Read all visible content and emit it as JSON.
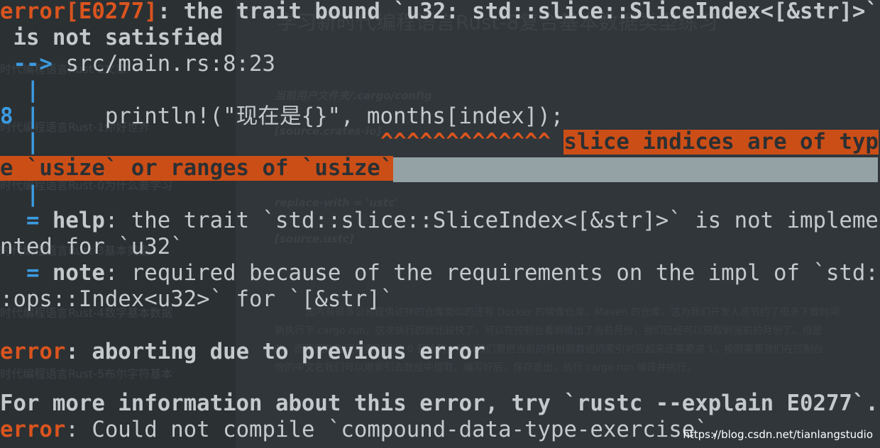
{
  "background_editor": {
    "title": "学习新时代编程语言Rust-8复合基本数据类型练习",
    "sidebar_items": [
      "时代编程语言Rust-2文章",
      "时代编程语言Rust-1你好世界",
      "时代编程语言Rust-0",
      "时代编程语言Rust-0为什么要学习",
      "时代编程语言Rust-3基本类型",
      "时代编程语言Rust-4数字基本数据",
      "时代编程语言Rust-5布尔字符基本"
    ],
    "content_lines": [
      "当前用户文件夹/.cargo/config",
      "[source.crates-io]",
      "replace-with = 'ustc'",
      "[source.ustc]",
      "国内有很多公司提供这样的仓库类似的还有 Docker 的镜像仓库、Maven 的仓库，这为我们开发人员节约了很多下载时间",
      "新执行下 cargo run，这次执行的就比较快了，可以在控制台看到输出了当前月份，我们已经可以获取到当前的月份了。但是",
      "的，而我们的数组的索引是从 0 开始的，所以我们要把当前的月份跟数组的索引对应起来还需要减 1，按照需要我们在控制台",
      "份的中文名我们可以用索引去数组中提取。编写好后，保存退出，执行 cargo run 编译并执行。"
    ]
  },
  "terminal": {
    "l1_err": "error[E0277]",
    "l1_rest": ": the trait bound `u32: std::slice::SliceIndex<[&str]>`",
    "l2": " is not satisfied",
    "l3_arrow": " -->",
    "l3_loc": " src/main.rs:8:23",
    "gutter": "  |",
    "l5_num": "8",
    "l5_bar": " |",
    "l5_code": "     println!(\"现在是{}\", months[index]);",
    "l6_pad": "                          ",
    "l6_carets": "^^^^^^^^^^^^^",
    "l6_label": "slice indices are of typ",
    "l7_label": "e `usize` or ranges of `usize`",
    "eq": "  = ",
    "help": "help",
    "help_text": ": the trait `std::slice::SliceIndex<[&str]>` is not impleme",
    "help_cont": "nted for `u32`",
    "note": "note",
    "note_text": ": required because of the requirements on the impl of `std:",
    "note_cont": ":ops::Index<u32>` for `[&str]`",
    "abort_err": "error",
    "abort_text": ": aborting due to previous error",
    "more_info": "For more information about this error, try `rustc --explain E0277`.",
    "final_err": "error",
    "final_text": ": Could not compile `compound-data-type-exercise`."
  },
  "watermark": "https://blog.csdn.net/tianlangstudio",
  "colors": {
    "background": "#2b3033",
    "error": "#d9541e",
    "gutter": "#3c9be0",
    "text": "#c3cacc",
    "label_bg": "#cc4e17",
    "bar": "#94a2a5"
  }
}
